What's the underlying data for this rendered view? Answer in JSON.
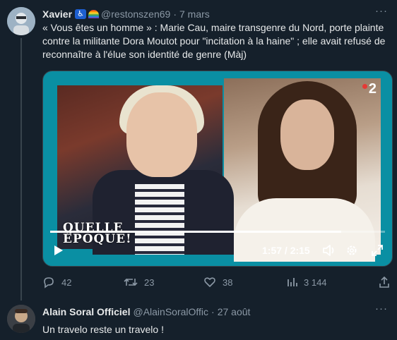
{
  "tweet1": {
    "author_name": "Xavier",
    "handle": "@restonszen69",
    "separator": "·",
    "date": "7 mars",
    "more": "···",
    "text": "« Vous êtes un homme » : Marie Cau, maire transgenre du Nord, porte plainte contre la militante Dora Moutot pour \"incitation à la haine\" ; elle avait refusé de reconnaître à l'élue son identité de genre (Màj)",
    "video": {
      "show_logo_line1": "QUELLE",
      "show_logo_line2": "ÉPOQUE!",
      "channel": "2",
      "time": "1:57 / 2:15",
      "progress": 0.87
    },
    "actions": {
      "reply_count": "42",
      "retweet_count": "23",
      "like_count": "38",
      "views_count": "3 144"
    }
  },
  "tweet2": {
    "author_name": "Alain Soral Officiel",
    "handle": "@AlainSoralOffic",
    "separator": "·",
    "date": "27 août",
    "more": "···",
    "text": "Un travelo reste un travelo !"
  },
  "icons": {
    "accessibility": "accessibility-icon",
    "rainbow": "rainbow-flag-icon",
    "reply": "reply-icon",
    "retweet": "retweet-icon",
    "like": "heart-icon",
    "views": "views-icon",
    "share": "share-icon",
    "play": "play-icon",
    "volume": "volume-icon",
    "settings": "gear-icon",
    "fullscreen": "fullscreen-icon"
  },
  "colors": {
    "background": "#15202b",
    "text": "#e7e9ea",
    "muted": "#8b98a5",
    "border": "#38444d",
    "video_accent": "#0a8fa3"
  }
}
